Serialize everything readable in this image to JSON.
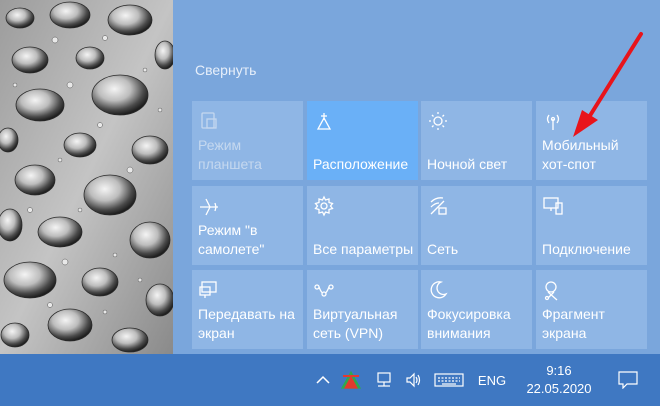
{
  "action_center": {
    "collapse_label": "Свернуть",
    "tiles": [
      {
        "label": "Режим\nпланшета",
        "icon": "tablet-mode-icon",
        "state": "disabled"
      },
      {
        "label": "Расположение",
        "icon": "location-icon",
        "state": "active"
      },
      {
        "label": "Ночной свет",
        "icon": "brightness-icon",
        "state": "off"
      },
      {
        "label": "Мобильный\nхот-спот",
        "icon": "mobile-hotspot-icon",
        "state": "off"
      },
      {
        "label": "Режим \"в\nсамолете\"",
        "icon": "airplane-icon",
        "state": "off"
      },
      {
        "label": "Все параметры",
        "icon": "settings-gear-icon",
        "state": "off"
      },
      {
        "label": "Сеть",
        "icon": "network-icon",
        "state": "off"
      },
      {
        "label": "Подключение",
        "icon": "connect-icon",
        "state": "off"
      },
      {
        "label": "Передавать на\nэкран",
        "icon": "project-icon",
        "state": "off"
      },
      {
        "label": "Виртуальная\nсеть (VPN)",
        "icon": "vpn-icon",
        "state": "off"
      },
      {
        "label": "Фокусировка\nвнимания",
        "icon": "focus-assist-icon",
        "state": "off"
      },
      {
        "label": "Фрагмент\nэкрана",
        "icon": "screen-snip-icon",
        "state": "off"
      }
    ]
  },
  "taskbar": {
    "language": "ENG",
    "time": "9:16",
    "date": "22.05.2020"
  },
  "colors": {
    "panel": "#7aa6dc",
    "tile": "#8fb6e5",
    "tile_active": "#6ab0f7",
    "taskbar": "#3f78c2",
    "arrow": "#e8141b"
  }
}
